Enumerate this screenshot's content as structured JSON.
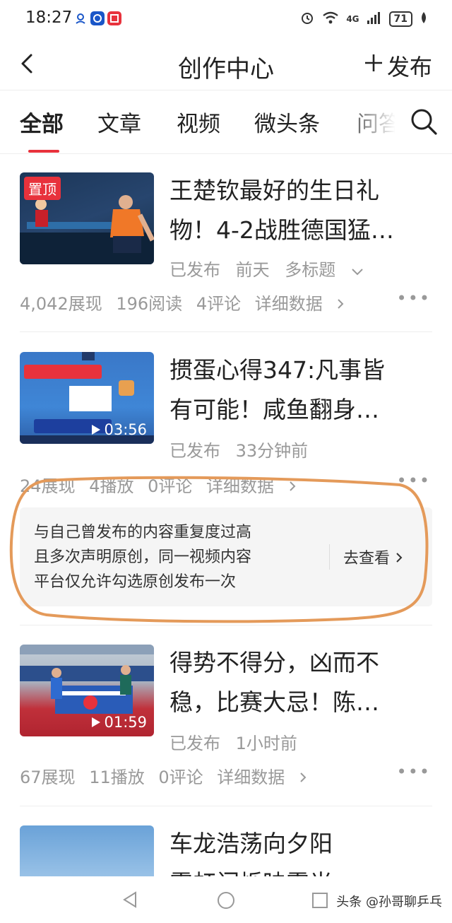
{
  "status_bar": {
    "time": "18:27",
    "battery": "71",
    "signal_label": "4G",
    "app_icons": [
      "location-icon",
      "browser-icon",
      "news-app-icon"
    ]
  },
  "header": {
    "back_icon": "chevron-left-icon",
    "title": "创作中心",
    "publish_label": "发布",
    "publish_icon": "plus-icon"
  },
  "tabs": {
    "items": [
      "全部",
      "文章",
      "视频",
      "微头条",
      "问答"
    ],
    "active_index": 0,
    "search_icon": "search-icon",
    "accent_color": "#e8323c"
  },
  "articles": [
    {
      "pinned_label": "置顶",
      "title_line1": "王楚钦最好的生日礼",
      "title_line2": "物！4-2战胜德国猛…",
      "status": "已发布",
      "time": "前天",
      "extra": "多标题",
      "stats": [
        "4,042展现",
        "196阅读",
        "4评论"
      ],
      "detail_label": "详细数据"
    },
    {
      "duration": "03:56",
      "title_line1": "掼蛋心得347:凡事皆",
      "title_line2": "有可能！咸鱼翻身…",
      "status": "已发布",
      "time": "33分钟前",
      "stats": [
        "24展现",
        "4播放",
        "0评论"
      ],
      "detail_label": "详细数据",
      "warning": {
        "line1": "与自己曾发布的内容重复度过高",
        "line2": "且多次声明原创，同一视频内容",
        "line3": "平台仅允许勾选原创发布一次",
        "action_label": "去查看"
      }
    },
    {
      "duration": "01:59",
      "title_line1": "得势不得分，凶而不",
      "title_line2": "稳，比赛大忌！陈…",
      "status": "已发布",
      "time": "1小时前",
      "stats": [
        "67展现",
        "11播放",
        "0评论"
      ],
      "detail_label": "详细数据"
    },
    {
      "title_line1": "车龙浩荡向夕阳",
      "title_line2": "霞虹闪烁映霞光"
    }
  ],
  "more_icon": "more-dots-icon",
  "watermark": "头条 @孙哥聊乒乓"
}
